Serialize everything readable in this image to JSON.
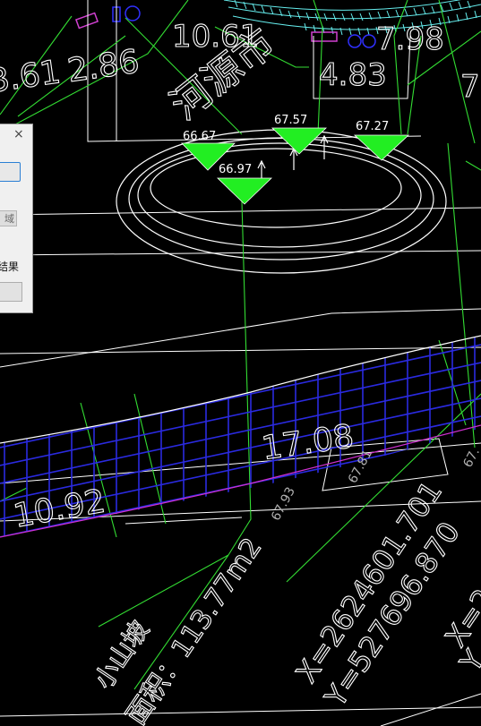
{
  "drawing": {
    "labels": {
      "num_361": "3.61",
      "num_286": "2.86",
      "num_1061": "10.61",
      "num_198": "7.98",
      "num_483": "4.83",
      "num_7": "7",
      "river_text": "河源市",
      "elev_1": "66.67",
      "elev_2": "67.57",
      "elev_3": "67.27",
      "elev_4": "66.97",
      "num_1708": "17.08",
      "num_1092": "10.92",
      "elev_6793": "67.93",
      "elev_6781": "67.81",
      "elev_67r": "67.",
      "area_name": "小山坡",
      "area_text": "面积：113.77m2",
      "coord_x": "X=2624601.701",
      "coord_y": "Y=527696.870",
      "coord_x2": "X=2",
      "coord_y2": "Y"
    },
    "colors": {
      "background": "#000000",
      "triangle": "#22ee22",
      "green_lines": "#33dd33",
      "blue_hatch": "#2a2ae0",
      "magenta_line": "#d030d0",
      "cyan_pattern": "#66eeee",
      "white_lines": "#ffffff"
    }
  },
  "dialog": {
    "close_icon": "×",
    "region_button_label": "域",
    "result_label": "结果"
  }
}
